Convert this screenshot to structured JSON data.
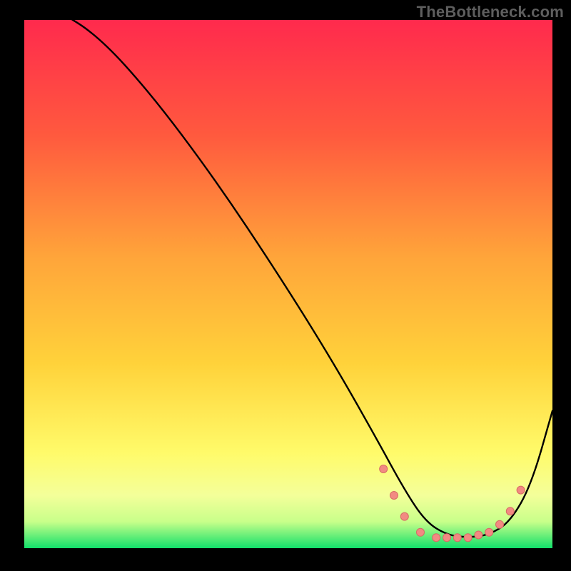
{
  "watermark": "TheBottleneck.com",
  "colors": {
    "bg_black": "#000000",
    "gradient_top": "#ff2a4d",
    "gradient_mid1": "#ff7c3a",
    "gradient_mid2": "#ffd23a",
    "gradient_low": "#fffb6a",
    "gradient_base1": "#f8ffa0",
    "gradient_base2": "#c8ff8a",
    "gradient_bottom": "#12e06a",
    "curve": "#000000",
    "dot_fill": "#f28a82",
    "dot_stroke": "#d66b64"
  },
  "chart_data": {
    "type": "line",
    "title": "",
    "xlabel": "",
    "ylabel": "",
    "xlim": [
      0,
      100
    ],
    "ylim": [
      0,
      100
    ],
    "series": [
      {
        "name": "bottleneck-curve",
        "x": [
          0,
          6,
          14,
          24,
          36,
          48,
          58,
          66,
          72,
          76,
          80,
          84,
          88,
          92,
          96,
          100
        ],
        "y": [
          105,
          102,
          97,
          86,
          70,
          52,
          36,
          22,
          11,
          5,
          2.5,
          2,
          2.5,
          5,
          12,
          26
        ]
      }
    ],
    "valley_points": {
      "name": "optimal-range-dots",
      "x": [
        68,
        70,
        72,
        75,
        78,
        80,
        82,
        84,
        86,
        88,
        90,
        92,
        94
      ],
      "y": [
        15,
        10,
        6,
        3,
        2,
        2,
        2,
        2,
        2.5,
        3,
        4.5,
        7,
        11
      ]
    }
  }
}
